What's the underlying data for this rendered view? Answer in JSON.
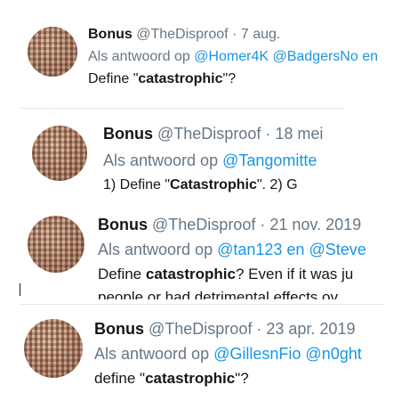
{
  "tweets": [
    {
      "name": "Bonus",
      "handle": "@TheDisproof",
      "date": "7 aug.",
      "reply_prefix": "Als antwoord op",
      "mentions": [
        "@Homer4K",
        "@BadgersNo en"
      ],
      "text_parts": [
        "Define \"",
        "catastrophic",
        "\"?"
      ]
    },
    {
      "name": "Bonus",
      "handle": "@TheDisproof",
      "date": "18 mei",
      "reply_prefix": "Als antwoord op",
      "mentions": [
        "@Tangomitte"
      ],
      "text_parts": [
        "1) Define \"",
        "Catastrophic",
        "\".  2) G"
      ]
    },
    {
      "name": "Bonus",
      "handle": "@TheDisproof",
      "date": "21 nov. 2019",
      "reply_prefix": "Als antwoord op",
      "mentions": [
        "@tan123 en @Steve"
      ],
      "text_parts": [
        "Define ",
        "catastrophic",
        "? Even if it was ju"
      ],
      "text_line2": "people or had detrimental effects ov"
    },
    {
      "name": "Bonus",
      "handle": "@TheDisproof",
      "date": "23 apr. 2019",
      "reply_prefix": "Als antwoord op",
      "mentions": [
        "@GillesnFio",
        "@n0ght"
      ],
      "text_parts": [
        "define \"",
        "catastrophic",
        "\"?"
      ]
    }
  ],
  "separator": "·"
}
